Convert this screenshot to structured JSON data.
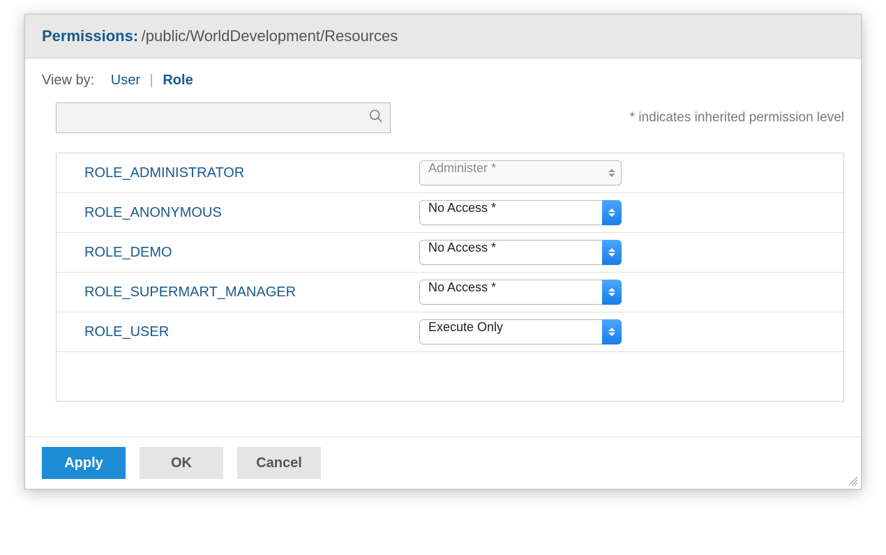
{
  "header": {
    "title_label": "Permissions:",
    "title_path": "/public/WorldDevelopment/Resources"
  },
  "viewby": {
    "label": "View by:",
    "user_tab": "User",
    "role_tab": "Role",
    "active": "Role"
  },
  "search": {
    "value": "",
    "placeholder": ""
  },
  "legend": "* indicates inherited permission level",
  "roles": [
    {
      "name": "ROLE_ADMINISTRATOR",
      "permission": "Administer *",
      "disabled": true
    },
    {
      "name": "ROLE_ANONYMOUS",
      "permission": "No Access *",
      "disabled": false
    },
    {
      "name": "ROLE_DEMO",
      "permission": "No Access *",
      "disabled": false
    },
    {
      "name": "ROLE_SUPERMART_MANAGER",
      "permission": "No Access *",
      "disabled": false
    },
    {
      "name": "ROLE_USER",
      "permission": "Execute Only",
      "disabled": false
    }
  ],
  "footer": {
    "apply": "Apply",
    "ok": "OK",
    "cancel": "Cancel"
  }
}
